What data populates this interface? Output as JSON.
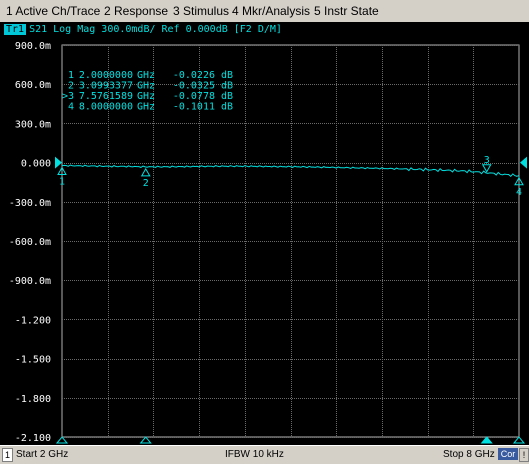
{
  "menu": {
    "items": [
      {
        "label": "1 Active Ch/Trace"
      },
      {
        "label": "2 Response"
      },
      {
        "label": "3 Stimulus"
      },
      {
        "label": "4 Mkr/Analysis"
      },
      {
        "label": "5 Instr State"
      }
    ]
  },
  "trace": {
    "badge": "Tr1",
    "header": "S21 Log Mag 300.0mdB/ Ref 0.000dB [F2 D/M]",
    "color": "#00e0e0"
  },
  "marker_table": {
    "rows": [
      {
        "prefix": "",
        "id": "1",
        "freq": "2.0000000",
        "unit": "GHz",
        "value": "-0.0226",
        "vunit": "dB"
      },
      {
        "prefix": "",
        "id": "2",
        "freq": "3.0993377",
        "unit": "GHz",
        "value": "-0.0325",
        "vunit": "dB"
      },
      {
        "prefix": ">",
        "id": "3",
        "freq": "7.5761589",
        "unit": "GHz",
        "value": "-0.0778",
        "vunit": "dB"
      },
      {
        "prefix": "",
        "id": "4",
        "freq": "8.0000000",
        "unit": "GHz",
        "value": "-0.1011",
        "vunit": "dB"
      }
    ]
  },
  "chart_data": {
    "type": "line",
    "ylabel_unit": "dB",
    "ylim": [
      -2.1,
      0.9
    ],
    "xlim": [
      2,
      8
    ],
    "grid": true,
    "y_tick_labels": [
      "900.0m",
      "600.0m",
      "300.0m",
      "0.000",
      "-300.0m",
      "-600.0m",
      "-900.0m",
      "-1.200",
      "-1.500",
      "-1.800",
      "-2.100"
    ],
    "y_ticks": [
      0.9,
      0.6,
      0.3,
      0.0,
      -0.3,
      -0.6,
      -0.9,
      -1.2,
      -1.5,
      -1.8,
      -2.1
    ],
    "series": [
      {
        "x": [
          2.0,
          2.3,
          2.6,
          2.9,
          3.1,
          3.4,
          3.7,
          4.0,
          4.3,
          4.6,
          4.9,
          5.2,
          5.5,
          5.8,
          6.1,
          6.4,
          6.7,
          7.0,
          7.3,
          7.576,
          7.8,
          8.0
        ],
        "y": [
          -0.0226,
          -0.025,
          -0.028,
          -0.03,
          -0.0325,
          -0.032,
          -0.03,
          -0.028,
          -0.027,
          -0.029,
          -0.031,
          -0.033,
          -0.036,
          -0.04,
          -0.043,
          -0.047,
          -0.052,
          -0.058,
          -0.065,
          -0.0778,
          -0.09,
          -0.1011
        ]
      }
    ],
    "markers": [
      {
        "id": "1",
        "x": 2.0,
        "y": -0.0226,
        "label_pos": "below"
      },
      {
        "id": "2",
        "x": 3.0993377,
        "y": -0.0325,
        "label_pos": "below"
      },
      {
        "id": "3",
        "x": 7.5761589,
        "y": -0.0778,
        "label_pos": "above"
      },
      {
        "id": "4",
        "x": 8.0,
        "y": -0.1011,
        "label_pos": "below"
      }
    ]
  },
  "status": {
    "channel": "1",
    "start": "Start 2 GHz",
    "ifbw": "IFBW 10 kHz",
    "stop": "Stop 8 GHz",
    "cor": "Cor",
    "warn": "!"
  }
}
